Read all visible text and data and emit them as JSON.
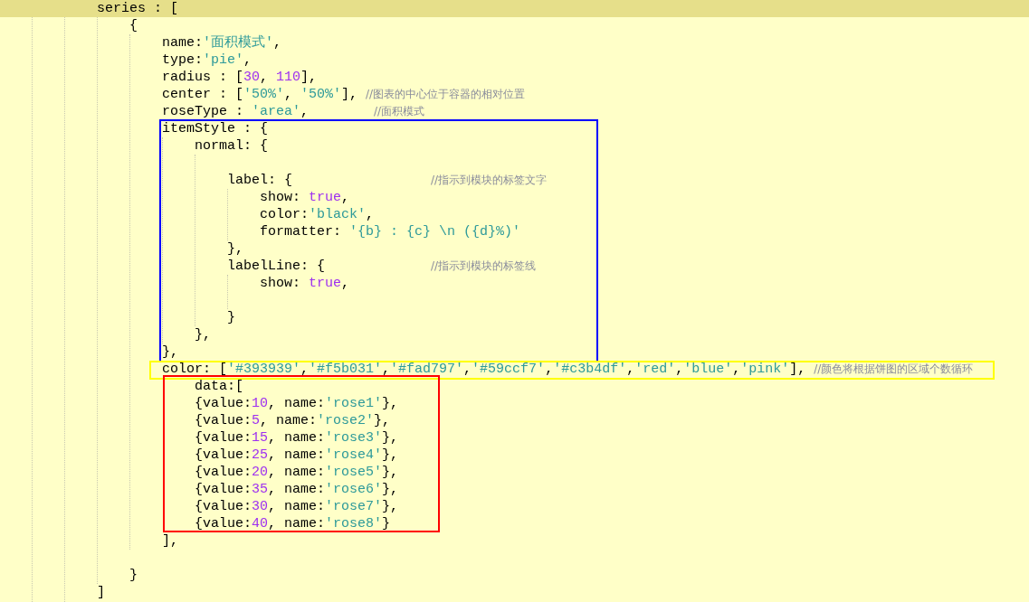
{
  "editor": {
    "lines": [
      {
        "kind": "line",
        "current": true,
        "tokens": [
          {
            "kind": "plain",
            "text": "series : ["
          }
        ],
        "children": [
          {
            "kind": "line",
            "current": false,
            "tokens": [
              {
                "kind": "plain",
                "text": "{"
              }
            ],
            "children": [
              {
                "kind": "line",
                "current": false,
                "tokens": [
                  {
                    "kind": "plain",
                    "text": "name:"
                  },
                  {
                    "kind": "string",
                    "text": "'面积模式'"
                  },
                  {
                    "kind": "plain",
                    "text": ","
                  }
                ]
              },
              {
                "kind": "line",
                "current": false,
                "tokens": [
                  {
                    "kind": "plain",
                    "text": "type:"
                  },
                  {
                    "kind": "string",
                    "text": "'pie'"
                  },
                  {
                    "kind": "plain",
                    "text": ","
                  }
                ]
              },
              {
                "kind": "line",
                "current": false,
                "tokens": [
                  {
                    "kind": "plain",
                    "text": "radius : ["
                  },
                  {
                    "kind": "number",
                    "text": "30"
                  },
                  {
                    "kind": "plain",
                    "text": ", "
                  },
                  {
                    "kind": "number",
                    "text": "110"
                  },
                  {
                    "kind": "plain",
                    "text": "],"
                  }
                ]
              },
              {
                "kind": "line",
                "current": false,
                "tokens": [
                  {
                    "kind": "plain",
                    "text": "center : ["
                  },
                  {
                    "kind": "string",
                    "text": "'50%'"
                  },
                  {
                    "kind": "plain",
                    "text": ", "
                  },
                  {
                    "kind": "string",
                    "text": "'50%'"
                  },
                  {
                    "kind": "plain",
                    "text": "], "
                  },
                  {
                    "kind": "comment",
                    "text": "//图表的中心位于容器的相对位置"
                  }
                ]
              },
              {
                "kind": "line",
                "current": false,
                "tokens": [
                  {
                    "kind": "plain",
                    "text": "roseType : "
                  },
                  {
                    "kind": "string",
                    "text": "'area'"
                  },
                  {
                    "kind": "plain",
                    "text": ",        "
                  },
                  {
                    "kind": "comment",
                    "text": "//面积模式"
                  }
                ]
              },
              {
                "kind": "box",
                "color": "#0000ff",
                "children": [
                  {
                    "kind": "line",
                    "current": false,
                    "tokens": [
                      {
                        "kind": "plain",
                        "text": "itemStyle : {"
                      }
                    ],
                    "children": [
                      {
                        "kind": "line",
                        "current": false,
                        "tokens": [
                          {
                            "kind": "plain",
                            "text": "normal: {"
                          }
                        ],
                        "children": [
                          {
                            "kind": "blank"
                          },
                          {
                            "kind": "line",
                            "current": false,
                            "tokens": [
                              {
                                "kind": "plain",
                                "text": "label: {                 "
                              },
                              {
                                "kind": "comment",
                                "text": "//指示到模块的标签文字"
                              }
                            ],
                            "children": [
                              {
                                "kind": "line",
                                "current": false,
                                "tokens": [
                                  {
                                    "kind": "plain",
                                    "text": "show: "
                                  },
                                  {
                                    "kind": "keyword",
                                    "text": "true"
                                  },
                                  {
                                    "kind": "plain",
                                    "text": ","
                                  }
                                ]
                              },
                              {
                                "kind": "line",
                                "current": false,
                                "tokens": [
                                  {
                                    "kind": "plain",
                                    "text": "color:"
                                  },
                                  {
                                    "kind": "string",
                                    "text": "'black'"
                                  },
                                  {
                                    "kind": "plain",
                                    "text": ","
                                  }
                                ]
                              },
                              {
                                "kind": "line",
                                "current": false,
                                "tokens": [
                                  {
                                    "kind": "plain",
                                    "text": "formatter: "
                                  },
                                  {
                                    "kind": "string",
                                    "text": "'{b} : {c} \\n ({d}%)'"
                                  }
                                ]
                              }
                            ]
                          },
                          {
                            "kind": "line",
                            "current": false,
                            "tokens": [
                              {
                                "kind": "plain",
                                "text": "},"
                              }
                            ]
                          },
                          {
                            "kind": "line",
                            "current": false,
                            "tokens": [
                              {
                                "kind": "plain",
                                "text": "labelLine: {             "
                              },
                              {
                                "kind": "comment",
                                "text": "//指示到模块的标签线"
                              }
                            ],
                            "children": [
                              {
                                "kind": "line",
                                "current": false,
                                "tokens": [
                                  {
                                    "kind": "plain",
                                    "text": "show: "
                                  },
                                  {
                                    "kind": "keyword",
                                    "text": "true"
                                  },
                                  {
                                    "kind": "plain",
                                    "text": ","
                                  }
                                ]
                              },
                              {
                                "kind": "blank"
                              }
                            ]
                          },
                          {
                            "kind": "line",
                            "current": false,
                            "tokens": [
                              {
                                "kind": "plain",
                                "text": "}"
                              }
                            ]
                          }
                        ]
                      },
                      {
                        "kind": "line",
                        "current": false,
                        "tokens": [
                          {
                            "kind": "plain",
                            "text": "},"
                          }
                        ]
                      }
                    ]
                  },
                  {
                    "kind": "line",
                    "current": false,
                    "tokens": [
                      {
                        "kind": "plain",
                        "text": "},"
                      }
                    ]
                  }
                ]
              },
              {
                "kind": "box",
                "color": "#ffff00",
                "children": [
                  {
                    "kind": "line",
                    "current": false,
                    "tokens": [
                      {
                        "kind": "plain",
                        "text": "color: ["
                      },
                      {
                        "kind": "string",
                        "text": "'#393939'"
                      },
                      {
                        "kind": "plain",
                        "text": ","
                      },
                      {
                        "kind": "string",
                        "text": "'#f5b031'"
                      },
                      {
                        "kind": "plain",
                        "text": ","
                      },
                      {
                        "kind": "string",
                        "text": "'#fad797'"
                      },
                      {
                        "kind": "plain",
                        "text": ","
                      },
                      {
                        "kind": "string",
                        "text": "'#59ccf7'"
                      },
                      {
                        "kind": "plain",
                        "text": ","
                      },
                      {
                        "kind": "string",
                        "text": "'#c3b4df'"
                      },
                      {
                        "kind": "plain",
                        "text": ","
                      },
                      {
                        "kind": "string",
                        "text": "'red'"
                      },
                      {
                        "kind": "plain",
                        "text": ","
                      },
                      {
                        "kind": "string",
                        "text": "'blue'"
                      },
                      {
                        "kind": "plain",
                        "text": ","
                      },
                      {
                        "kind": "string",
                        "text": "'pink'"
                      },
                      {
                        "kind": "plain",
                        "text": "], "
                      },
                      {
                        "kind": "comment",
                        "text": "//颜色将根据饼图的区域个数循环"
                      }
                    ]
                  }
                ]
              },
              {
                "kind": "indent",
                "children": [
                  {
                    "kind": "box",
                    "color": "#ff0000",
                    "children": [
                      {
                        "kind": "line",
                        "current": false,
                        "tokens": [
                          {
                            "kind": "plain",
                            "text": "data:["
                          }
                        ]
                      },
                      {
                        "kind": "line",
                        "current": false,
                        "tokens": [
                          {
                            "kind": "plain",
                            "text": "{value:"
                          },
                          {
                            "kind": "number",
                            "text": "10"
                          },
                          {
                            "kind": "plain",
                            "text": ", name:"
                          },
                          {
                            "kind": "string",
                            "text": "'rose1'"
                          },
                          {
                            "kind": "plain",
                            "text": "},"
                          }
                        ]
                      },
                      {
                        "kind": "line",
                        "current": false,
                        "tokens": [
                          {
                            "kind": "plain",
                            "text": "{value:"
                          },
                          {
                            "kind": "number",
                            "text": "5"
                          },
                          {
                            "kind": "plain",
                            "text": ", name:"
                          },
                          {
                            "kind": "string",
                            "text": "'rose2'"
                          },
                          {
                            "kind": "plain",
                            "text": "},"
                          }
                        ]
                      },
                      {
                        "kind": "line",
                        "current": false,
                        "tokens": [
                          {
                            "kind": "plain",
                            "text": "{value:"
                          },
                          {
                            "kind": "number",
                            "text": "15"
                          },
                          {
                            "kind": "plain",
                            "text": ", name:"
                          },
                          {
                            "kind": "string",
                            "text": "'rose3'"
                          },
                          {
                            "kind": "plain",
                            "text": "},"
                          }
                        ]
                      },
                      {
                        "kind": "line",
                        "current": false,
                        "tokens": [
                          {
                            "kind": "plain",
                            "text": "{value:"
                          },
                          {
                            "kind": "number",
                            "text": "25"
                          },
                          {
                            "kind": "plain",
                            "text": ", name:"
                          },
                          {
                            "kind": "string",
                            "text": "'rose4'"
                          },
                          {
                            "kind": "plain",
                            "text": "},"
                          }
                        ]
                      },
                      {
                        "kind": "line",
                        "current": false,
                        "tokens": [
                          {
                            "kind": "plain",
                            "text": "{value:"
                          },
                          {
                            "kind": "number",
                            "text": "20"
                          },
                          {
                            "kind": "plain",
                            "text": ", name:"
                          },
                          {
                            "kind": "string",
                            "text": "'rose5'"
                          },
                          {
                            "kind": "plain",
                            "text": "},"
                          }
                        ]
                      },
                      {
                        "kind": "line",
                        "current": false,
                        "tokens": [
                          {
                            "kind": "plain",
                            "text": "{value:"
                          },
                          {
                            "kind": "number",
                            "text": "35"
                          },
                          {
                            "kind": "plain",
                            "text": ", name:"
                          },
                          {
                            "kind": "string",
                            "text": "'rose6'"
                          },
                          {
                            "kind": "plain",
                            "text": "},"
                          }
                        ]
                      },
                      {
                        "kind": "line",
                        "current": false,
                        "tokens": [
                          {
                            "kind": "plain",
                            "text": "{value:"
                          },
                          {
                            "kind": "number",
                            "text": "30"
                          },
                          {
                            "kind": "plain",
                            "text": ", name:"
                          },
                          {
                            "kind": "string",
                            "text": "'rose7'"
                          },
                          {
                            "kind": "plain",
                            "text": "},"
                          }
                        ]
                      },
                      {
                        "kind": "line",
                        "current": false,
                        "tokens": [
                          {
                            "kind": "plain",
                            "text": "{value:"
                          },
                          {
                            "kind": "number",
                            "text": "40"
                          },
                          {
                            "kind": "plain",
                            "text": ", name:"
                          },
                          {
                            "kind": "string",
                            "text": "'rose8'"
                          },
                          {
                            "kind": "plain",
                            "text": "}"
                          }
                        ]
                      }
                    ]
                  }
                ]
              },
              {
                "kind": "line",
                "current": false,
                "tokens": [
                  {
                    "kind": "plain",
                    "text": "],"
                  }
                ]
              }
            ]
          },
          {
            "kind": "blank"
          },
          {
            "kind": "line",
            "current": false,
            "tokens": [
              {
                "kind": "plain",
                "text": "}"
              }
            ]
          }
        ]
      },
      {
        "kind": "line",
        "current": false,
        "tokens": [
          {
            "kind": "plain",
            "text": "]"
          }
        ]
      }
    ]
  }
}
